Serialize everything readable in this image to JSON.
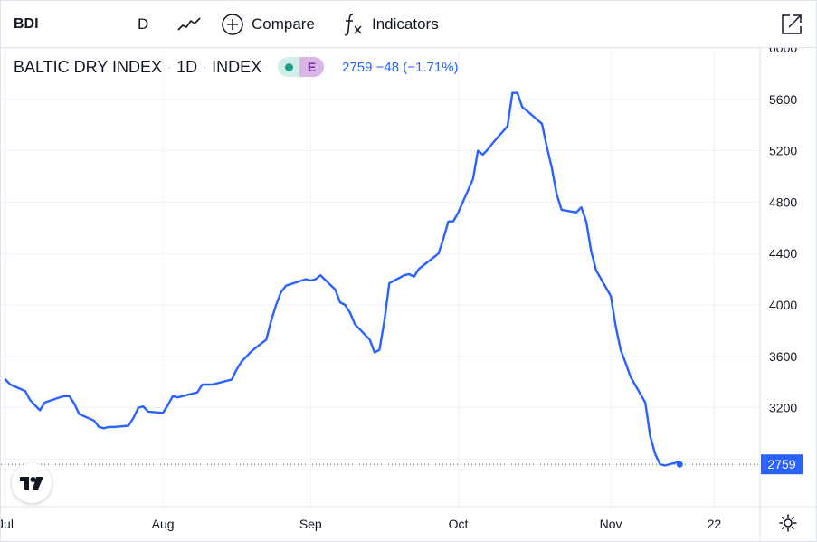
{
  "toolbar": {
    "symbol": "BDI",
    "interval": "D",
    "chart_type_icon": "line-chart-icon",
    "compare_label": "Compare",
    "indicators_label": "Indicators",
    "expand_icon": "expand-icon"
  },
  "legend": {
    "name": "BALTIC DRY INDEX",
    "interval": "1D",
    "type": "INDEX",
    "dot": "·",
    "badge_letter": "E",
    "values": "2759 −48 (−1.71%)"
  },
  "colors": {
    "line": "#2962ff",
    "grid": "#f0f3fa",
    "axis_text": "#131722",
    "last_label_bg": "#2962ff"
  },
  "chart_data": {
    "type": "line",
    "x": [
      "2021-07-01",
      "2021-07-02",
      "2021-07-05",
      "2021-07-06",
      "2021-07-07",
      "2021-07-08",
      "2021-07-09",
      "2021-07-12",
      "2021-07-13",
      "2021-07-14",
      "2021-07-15",
      "2021-07-16",
      "2021-07-19",
      "2021-07-20",
      "2021-07-21",
      "2021-07-22",
      "2021-07-23",
      "2021-07-26",
      "2021-07-27",
      "2021-07-28",
      "2021-07-29",
      "2021-07-30",
      "2021-08-02",
      "2021-08-03",
      "2021-08-04",
      "2021-08-05",
      "2021-08-06",
      "2021-08-09",
      "2021-08-10",
      "2021-08-11",
      "2021-08-12",
      "2021-08-13",
      "2021-08-16",
      "2021-08-17",
      "2021-08-18",
      "2021-08-19",
      "2021-08-20",
      "2021-08-23",
      "2021-08-24",
      "2021-08-25",
      "2021-08-26",
      "2021-08-27",
      "2021-08-31",
      "2021-09-01",
      "2021-09-02",
      "2021-09-03",
      "2021-09-06",
      "2021-09-07",
      "2021-09-08",
      "2021-09-09",
      "2021-09-10",
      "2021-09-13",
      "2021-09-14",
      "2021-09-15",
      "2021-09-16",
      "2021-09-17",
      "2021-09-20",
      "2021-09-21",
      "2021-09-22",
      "2021-09-23",
      "2021-09-24",
      "2021-09-27",
      "2021-09-28",
      "2021-09-29",
      "2021-09-30",
      "2021-10-01",
      "2021-10-04",
      "2021-10-05",
      "2021-10-06",
      "2021-10-07",
      "2021-10-08",
      "2021-10-11",
      "2021-10-12",
      "2021-10-13",
      "2021-10-14",
      "2021-10-15",
      "2021-10-18",
      "2021-10-19",
      "2021-10-20",
      "2021-10-21",
      "2021-10-22",
      "2021-10-25",
      "2021-10-26",
      "2021-10-27",
      "2021-10-28",
      "2021-10-29",
      "2021-11-01",
      "2021-11-02",
      "2021-11-03",
      "2021-11-04",
      "2021-11-05",
      "2021-11-08",
      "2021-11-09",
      "2021-11-10",
      "2021-11-11",
      "2021-11-12",
      "2021-11-15"
    ],
    "series": [
      {
        "values": [
          3420,
          3380,
          3330,
          3260,
          3220,
          3180,
          3240,
          3280,
          3290,
          3290,
          3230,
          3150,
          3100,
          3050,
          3040,
          3050,
          3050,
          3060,
          3120,
          3200,
          3210,
          3170,
          3160,
          3220,
          3290,
          3280,
          3290,
          3320,
          3380,
          3380,
          3380,
          3390,
          3420,
          3500,
          3560,
          3600,
          3640,
          3730,
          3880,
          4000,
          4100,
          4150,
          4200,
          4190,
          4200,
          4230,
          4120,
          4020,
          4000,
          3940,
          3850,
          3730,
          3630,
          3650,
          3880,
          4170,
          4230,
          4240,
          4220,
          4280,
          4310,
          4400,
          4520,
          4650,
          4650,
          4720,
          4980,
          5200,
          5170,
          5210,
          5260,
          5390,
          5650,
          5650,
          5540,
          5510,
          5410,
          5230,
          5070,
          4860,
          4740,
          4720,
          4760,
          4650,
          4420,
          4270,
          4070,
          3830,
          3650,
          3550,
          3440,
          3240,
          2980,
          2840,
          2760,
          2750,
          2780,
          2840,
          2840,
          2830,
          2800,
          2759
        ]
      }
    ],
    "ylim": [
      2750,
      6000
    ],
    "y_ticks": [
      6000,
      5600,
      5200,
      4800,
      4400,
      4000,
      3600,
      3200,
      2800
    ],
    "y_tick_labels": [
      "6000",
      "5600",
      "5200",
      "4800",
      "4400",
      "4000",
      "3600",
      "3200",
      "2759"
    ],
    "x_ticks": [
      {
        "date": "2021-07-01",
        "label": "Jul"
      },
      {
        "date": "2021-08-02",
        "label": "Aug"
      },
      {
        "date": "2021-09-01",
        "label": "Sep"
      },
      {
        "date": "2021-10-01",
        "label": "Oct"
      },
      {
        "date": "2021-11-01",
        "label": "Nov"
      },
      {
        "date": "2021-11-22",
        "label": "22"
      }
    ],
    "last_value": 2759,
    "grid": true
  }
}
